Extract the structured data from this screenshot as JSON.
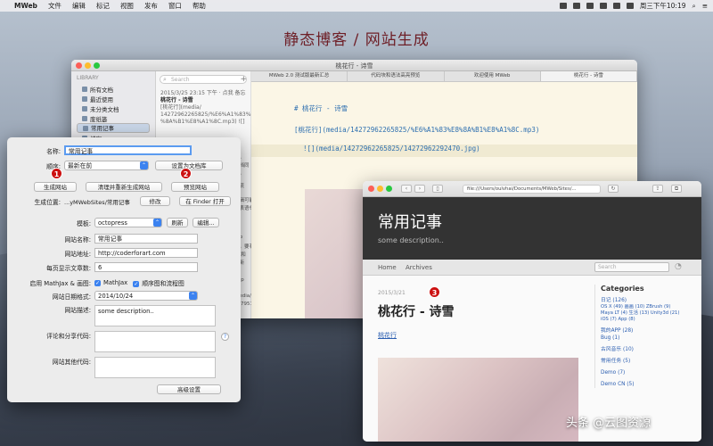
{
  "menubar": {
    "app": "MWeb",
    "items": [
      "文件",
      "编辑",
      "标记",
      "视图",
      "发布",
      "窗口",
      "帮助"
    ],
    "clock": "周三下午10:19"
  },
  "headline": "静态博客 / 网站生成",
  "mweb": {
    "title": "桃花行 - 诗雪",
    "library_heading": "LIBRARY",
    "library_items": [
      "所有文档",
      "最近使用",
      "未分类文档",
      "废纸篓",
      "常用记事",
      "博客"
    ],
    "search_placeholder": "Search",
    "note_date": "2015/3/25 23:15 下午 · 点我 备忘",
    "note_title": "桃花行 - 诗雪",
    "note_lines": [
      "[桃花行](media/",
      "14272962265825/%E6%A1%83%E8",
      "%8A%B1%E8%A1%8C.mp3) ![]"
    ],
    "fragments": [
      "档。",
      "文档同",
      "等。",
      "和流",
      "编辑可能",
      "等表语句",
      "Top",
      "记，要有",
      "ta 和",
      "重新",
      "App",
      "media/",
      "347951",
      "表本功能",
      "用于。",
      "Views",
      "113"
    ],
    "tabs": [
      "MWeb 2.0 测试版最新汇总",
      "代码块和语法高亮预览",
      "欢迎使用 MWeb",
      "桃花行 - 诗雪"
    ],
    "editor": {
      "heading": "# 桃花行 - 诗雪",
      "line1": "[桃花行](media/14272962265825/%E6%A1%83%E8%8A%B1%E8%A1%8C.mp3)",
      "line2": "![](media/14272962265825/14272962292470.jpg)"
    }
  },
  "settings": {
    "name_label": "名称:",
    "name_value": "常用记事",
    "order_label": "顺序:",
    "order_value": "最新在前",
    "set_as_library": "设置为文档库",
    "generate": "生成网站",
    "clean_regenerate": "清理并重新生成网站",
    "preview": "预览网站",
    "location_label": "生成位置:",
    "location_value": "...yMWebSites/常用记事",
    "modify": "修改",
    "open_finder": "在 Finder 打开",
    "template_label": "模板:",
    "template_value": "octopress",
    "refresh": "刷新",
    "edit": "编辑...",
    "site_name_label": "网站名称:",
    "site_name_value": "常用记事",
    "site_url_label": "网站地址:",
    "site_url_value": "http://coderforart.com",
    "per_page_label": "每页显示文章数:",
    "per_page_value": "6",
    "mathjax_label": "启用 MathJax & 画图:",
    "mathjax_check": "MathJax",
    "flow_check": "顺序图和流程图",
    "date_fmt_label": "网站日期格式:",
    "date_fmt_value": "2014/10/24",
    "desc_label": "网站描述:",
    "desc_value": "some description..",
    "comment_label": "评论和分享代码:",
    "other_label": "网站其他代码:",
    "help": "?",
    "advanced": "高级设置",
    "badges": [
      "1",
      "2"
    ]
  },
  "browser": {
    "address": "file:///Users/oulvhai/Documents/MWeb/Sites/...",
    "site_title": "常用记事",
    "site_sub": "some description..",
    "nav": [
      "Home",
      "Archives"
    ],
    "search_placeholder": "Search",
    "post_date": "2015/3/21",
    "post_title": "桃花行 - 诗雪",
    "post_link": "桃花行",
    "badge": "3",
    "categories_heading": "Categories",
    "categories": [
      "日记 (126)",
      "OS X (49)   画画 (10)   ZBrush (9)",
      "Maya LT (4)   生活 (13)   Unity3d (21)",
      "iOS (7)   App (8)",
      "我的APP (28)",
      "Bug (1)",
      "古风音乐 (10)",
      "常用任务 (5)",
      "Demo (7)",
      "Demo CN (5)"
    ]
  },
  "watermark": "头条 @云图资源"
}
